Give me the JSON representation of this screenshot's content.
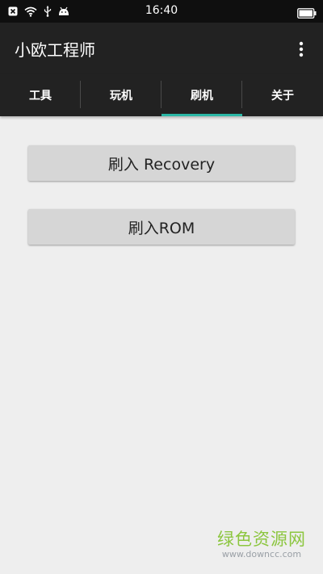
{
  "status_bar": {
    "time": "16:40",
    "icons": [
      "close-notification-icon",
      "wifi-icon",
      "usb-icon",
      "android-icon",
      "battery-icon"
    ]
  },
  "app_bar": {
    "title": "小欧工程师",
    "menu_icon": "overflow-menu-icon"
  },
  "tabs": [
    {
      "label": "工具",
      "selected": false
    },
    {
      "label": "玩机",
      "selected": false
    },
    {
      "label": "刷机",
      "selected": true
    },
    {
      "label": "关于",
      "selected": false
    }
  ],
  "actions": {
    "flash_recovery": "刷入 Recovery",
    "flash_rom": "刷入ROM"
  },
  "watermark": {
    "title": "绿色资源网",
    "url": "www.downcc.com"
  },
  "colors": {
    "toolbar": "#222222",
    "status_bar": "#0f0f0f",
    "tab_indicator": "#2bb7a5",
    "background": "#eeeeee",
    "button": "#d6d6d6",
    "watermark": "#8cc63f"
  }
}
